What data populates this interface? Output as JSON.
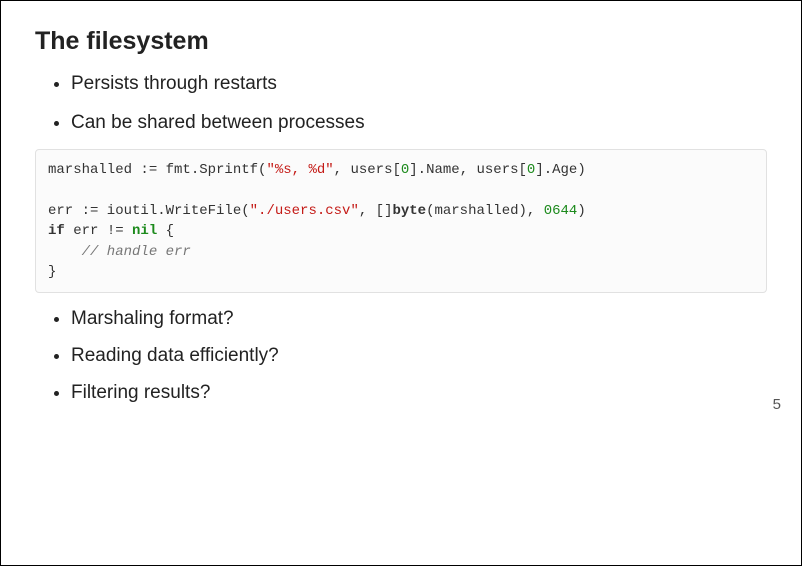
{
  "title": "The filesystem",
  "bullets_top": [
    "Persists through restarts",
    "Can be shared between processes"
  ],
  "code": {
    "l1a": "marshalled := fmt.Sprintf(",
    "l1b": "\"%s, %d\"",
    "l1c": ", users[",
    "l1d": "0",
    "l1e": "].Name, users[",
    "l1f": "0",
    "l1g": "].Age)",
    "l2a": "err := ioutil.WriteFile(",
    "l2b": "\"./users.csv\"",
    "l2c": ", []",
    "l2d": "byte",
    "l2e": "(marshalled), ",
    "l2f": "0644",
    "l2g": ")",
    "l3a": "if",
    "l3b": " err != ",
    "l3c": "nil",
    "l3d": " {",
    "l4": "    // handle err",
    "l5": "}"
  },
  "bullets_bottom": [
    "Marshaling format?",
    "Reading data efficiently?",
    "Filtering results?"
  ],
  "page_number": "5"
}
